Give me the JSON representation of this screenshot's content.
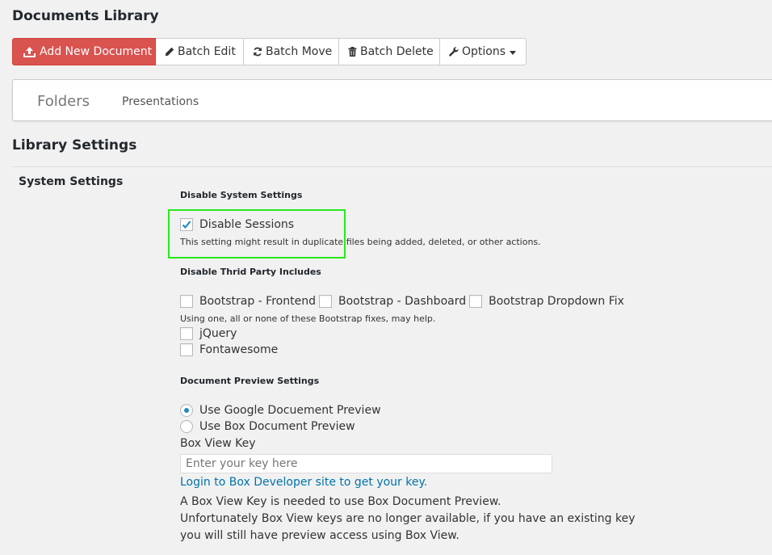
{
  "page": {
    "title": "Documents Library"
  },
  "toolbar": {
    "add_label": "Add New Document",
    "batch_edit_label": "Batch Edit",
    "batch_move_label": "Batch Move",
    "batch_delete_label": "Batch Delete",
    "options_label": "Options",
    "primary_color": "#d9534f"
  },
  "tabs": [
    {
      "label": "Folders"
    },
    {
      "label": "Presentations"
    }
  ],
  "settings": {
    "title": "Library Settings",
    "row_label": "System Settings",
    "disable_system": {
      "heading": "Disable System Settings",
      "sessions_label": "Disable Sessions",
      "sessions_checked": true,
      "sessions_desc": "This setting might result in duplicate files being added, deleted, or other actions."
    },
    "third_party": {
      "heading": "Disable Thrid Party Includes",
      "bootstrap_frontend": "Bootstrap - Frontend",
      "bootstrap_dashboard": "Bootstrap - Dashboard",
      "bootstrap_dropdown": "Bootstrap Dropdown Fix",
      "bootstrap_desc": "Using one, all or none of these Bootstrap fixes, may help.",
      "jquery": "jQuery",
      "fontawesome": "Fontawesome"
    },
    "preview": {
      "heading": "Document Preview Settings",
      "google_label": "Use Google Docuement Preview",
      "box_label": "Use Box Document Preview",
      "selected": "google",
      "key_label": "Box View Key",
      "key_placeholder": "Enter your key here",
      "key_value": "",
      "link_label": "Login to Box Developer site to get your key.",
      "note_1": "A Box View Key is needed to use Box Document Preview.",
      "note_2": "Unfortunately Box View keys are no longer available, if you have an existing key",
      "note_3": "you will still have preview access using Box View."
    }
  },
  "highlight_color": "#27e91c"
}
